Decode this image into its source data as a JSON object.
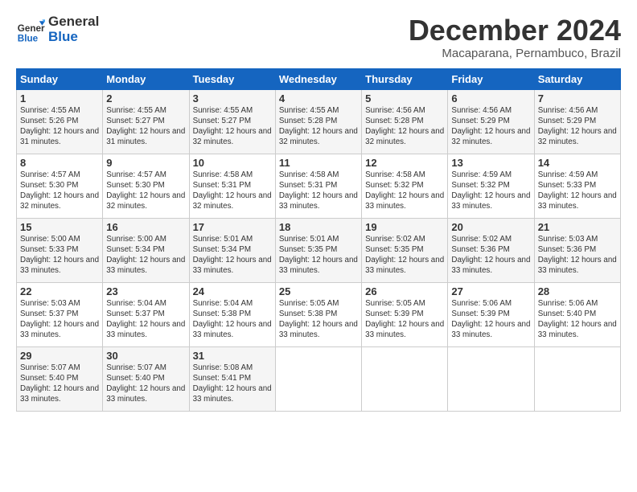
{
  "logo": {
    "line1": "General",
    "line2": "Blue"
  },
  "title": "December 2024",
  "subtitle": "Macaparana, Pernambuco, Brazil",
  "weekdays": [
    "Sunday",
    "Monday",
    "Tuesday",
    "Wednesday",
    "Thursday",
    "Friday",
    "Saturday"
  ],
  "weeks": [
    [
      {
        "day": "1",
        "sunrise": "4:55 AM",
        "sunset": "5:26 PM",
        "daylight": "12 hours and 31 minutes."
      },
      {
        "day": "2",
        "sunrise": "4:55 AM",
        "sunset": "5:27 PM",
        "daylight": "12 hours and 31 minutes."
      },
      {
        "day": "3",
        "sunrise": "4:55 AM",
        "sunset": "5:27 PM",
        "daylight": "12 hours and 32 minutes."
      },
      {
        "day": "4",
        "sunrise": "4:55 AM",
        "sunset": "5:28 PM",
        "daylight": "12 hours and 32 minutes."
      },
      {
        "day": "5",
        "sunrise": "4:56 AM",
        "sunset": "5:28 PM",
        "daylight": "12 hours and 32 minutes."
      },
      {
        "day": "6",
        "sunrise": "4:56 AM",
        "sunset": "5:29 PM",
        "daylight": "12 hours and 32 minutes."
      },
      {
        "day": "7",
        "sunrise": "4:56 AM",
        "sunset": "5:29 PM",
        "daylight": "12 hours and 32 minutes."
      }
    ],
    [
      {
        "day": "8",
        "sunrise": "4:57 AM",
        "sunset": "5:30 PM",
        "daylight": "12 hours and 32 minutes."
      },
      {
        "day": "9",
        "sunrise": "4:57 AM",
        "sunset": "5:30 PM",
        "daylight": "12 hours and 32 minutes."
      },
      {
        "day": "10",
        "sunrise": "4:58 AM",
        "sunset": "5:31 PM",
        "daylight": "12 hours and 32 minutes."
      },
      {
        "day": "11",
        "sunrise": "4:58 AM",
        "sunset": "5:31 PM",
        "daylight": "12 hours and 33 minutes."
      },
      {
        "day": "12",
        "sunrise": "4:58 AM",
        "sunset": "5:32 PM",
        "daylight": "12 hours and 33 minutes."
      },
      {
        "day": "13",
        "sunrise": "4:59 AM",
        "sunset": "5:32 PM",
        "daylight": "12 hours and 33 minutes."
      },
      {
        "day": "14",
        "sunrise": "4:59 AM",
        "sunset": "5:33 PM",
        "daylight": "12 hours and 33 minutes."
      }
    ],
    [
      {
        "day": "15",
        "sunrise": "5:00 AM",
        "sunset": "5:33 PM",
        "daylight": "12 hours and 33 minutes."
      },
      {
        "day": "16",
        "sunrise": "5:00 AM",
        "sunset": "5:34 PM",
        "daylight": "12 hours and 33 minutes."
      },
      {
        "day": "17",
        "sunrise": "5:01 AM",
        "sunset": "5:34 PM",
        "daylight": "12 hours and 33 minutes."
      },
      {
        "day": "18",
        "sunrise": "5:01 AM",
        "sunset": "5:35 PM",
        "daylight": "12 hours and 33 minutes."
      },
      {
        "day": "19",
        "sunrise": "5:02 AM",
        "sunset": "5:35 PM",
        "daylight": "12 hours and 33 minutes."
      },
      {
        "day": "20",
        "sunrise": "5:02 AM",
        "sunset": "5:36 PM",
        "daylight": "12 hours and 33 minutes."
      },
      {
        "day": "21",
        "sunrise": "5:03 AM",
        "sunset": "5:36 PM",
        "daylight": "12 hours and 33 minutes."
      }
    ],
    [
      {
        "day": "22",
        "sunrise": "5:03 AM",
        "sunset": "5:37 PM",
        "daylight": "12 hours and 33 minutes."
      },
      {
        "day": "23",
        "sunrise": "5:04 AM",
        "sunset": "5:37 PM",
        "daylight": "12 hours and 33 minutes."
      },
      {
        "day": "24",
        "sunrise": "5:04 AM",
        "sunset": "5:38 PM",
        "daylight": "12 hours and 33 minutes."
      },
      {
        "day": "25",
        "sunrise": "5:05 AM",
        "sunset": "5:38 PM",
        "daylight": "12 hours and 33 minutes."
      },
      {
        "day": "26",
        "sunrise": "5:05 AM",
        "sunset": "5:39 PM",
        "daylight": "12 hours and 33 minutes."
      },
      {
        "day": "27",
        "sunrise": "5:06 AM",
        "sunset": "5:39 PM",
        "daylight": "12 hours and 33 minutes."
      },
      {
        "day": "28",
        "sunrise": "5:06 AM",
        "sunset": "5:40 PM",
        "daylight": "12 hours and 33 minutes."
      }
    ],
    [
      {
        "day": "29",
        "sunrise": "5:07 AM",
        "sunset": "5:40 PM",
        "daylight": "12 hours and 33 minutes."
      },
      {
        "day": "30",
        "sunrise": "5:07 AM",
        "sunset": "5:40 PM",
        "daylight": "12 hours and 33 minutes."
      },
      {
        "day": "31",
        "sunrise": "5:08 AM",
        "sunset": "5:41 PM",
        "daylight": "12 hours and 33 minutes."
      },
      null,
      null,
      null,
      null
    ]
  ]
}
